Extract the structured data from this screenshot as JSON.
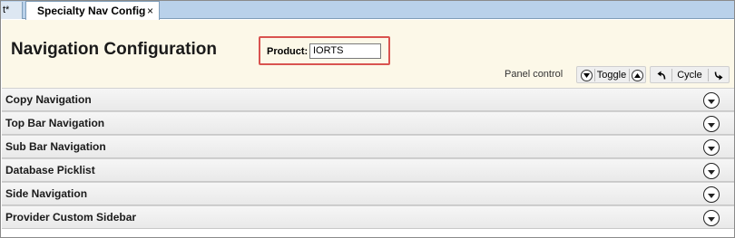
{
  "tabs": {
    "stub_label": "t*",
    "active_label": "Specialty Nav Config",
    "close_glyph": "×"
  },
  "header": {
    "title": "Navigation Configuration",
    "product_label": "Product:",
    "product_value": "IORTS",
    "panel_control_label": "Panel control",
    "toggle_label": "Toggle",
    "cycle_label": "Cycle"
  },
  "accordion": {
    "items": [
      {
        "label": "Copy Navigation"
      },
      {
        "label": "Top Bar Navigation"
      },
      {
        "label": "Sub Bar Navigation"
      },
      {
        "label": "Database Picklist"
      },
      {
        "label": "Side Navigation"
      },
      {
        "label": "Provider Custom Sidebar"
      }
    ]
  },
  "colors": {
    "highlight_border": "#d9534f",
    "header_background": "#fcf8e8",
    "tabstrip_background": "#b9d1ea"
  },
  "icons": {
    "expand": "chevron-down-circle-icon",
    "collapse": "chevron-up-circle-icon",
    "undo": "undo-arrow-icon",
    "redo": "redo-arrow-icon"
  }
}
